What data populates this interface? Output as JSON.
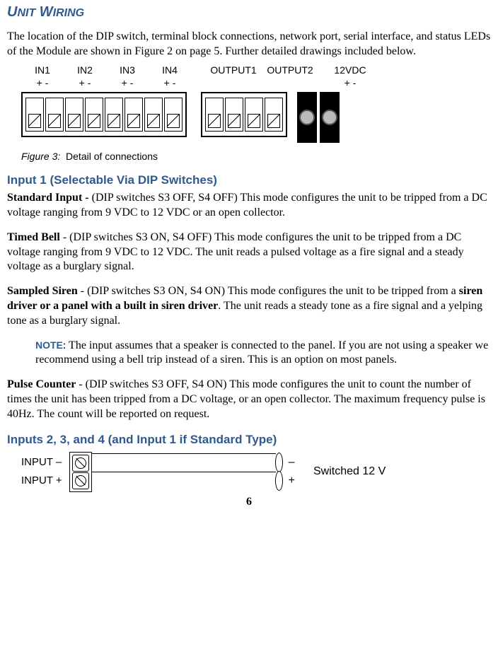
{
  "title": "UNIT WIRING",
  "intro": "The location of the DIP switch, terminal block connections, network port, serial interface, and status LEDs of the Module are shown in Figure 2 on page 5.  Further detailed drawings included below.",
  "figure": {
    "labels": {
      "in1": "IN1",
      "in1pm": "+   -",
      "in2": "IN2",
      "in2pm": "+   -",
      "in3": "IN3",
      "in3pm": "+   -",
      "in4": "IN4",
      "in4pm": "+   -",
      "out1": "OUTPUT1",
      "out2": "OUTPUT2",
      "pwr": "12VDC",
      "pwrpm": "+    -"
    },
    "caption_prefix": "Figure 3:",
    "caption": "Detail of connections"
  },
  "section2": {
    "heading": "Input 1 (Selectable Via DIP Switches)",
    "modes": {
      "standard": {
        "title": "Standard Input - ",
        "body": "(DIP switches S3 OFF, S4 OFF) This mode configures the unit to be tripped from a DC voltage ranging from 9 VDC to 12 VDC or an open collector."
      },
      "timed": {
        "title": "Timed Bell",
        "body": " - (DIP switches S3 ON, S4 OFF) This mode configures the unit to be tripped from a DC voltage ranging from 9 VDC to 12 VDC. The unit reads a pulsed voltage as a fire signal and a steady voltage as a burglary signal."
      },
      "sampled": {
        "title": "Sampled Siren",
        "body_pre": " - (DIP switches S3 ON, S4 ON) This mode configures the unit to be tripped from a ",
        "bold": "siren driver or a panel with a built in siren driver",
        "body_post": ". The unit reads a steady tone as a fire signal and a yelping tone as a burglary signal."
      },
      "note": {
        "label": "NOTE",
        "body": ": The input assumes that a speaker is connected to the panel. If you are not using a speaker we recommend using a bell trip instead of a siren. This is an option on most panels."
      },
      "pulse": {
        "title": "Pulse Counter",
        "body": " - (DIP switches S3 OFF, S4 ON) This mode configures the unit to count the number of times the unit has been tripped from a DC voltage, or an open collector. The maximum frequency pulse is 40Hz. The count will be reported on request."
      }
    }
  },
  "section3": {
    "heading": "Inputs 2, 3, and 4 (and Input 1 if Standard Type)",
    "input_minus": "INPUT –",
    "input_plus": "INPUT +",
    "minus": "–",
    "plus": "+",
    "switched": "Switched 12 V"
  },
  "page": "6"
}
